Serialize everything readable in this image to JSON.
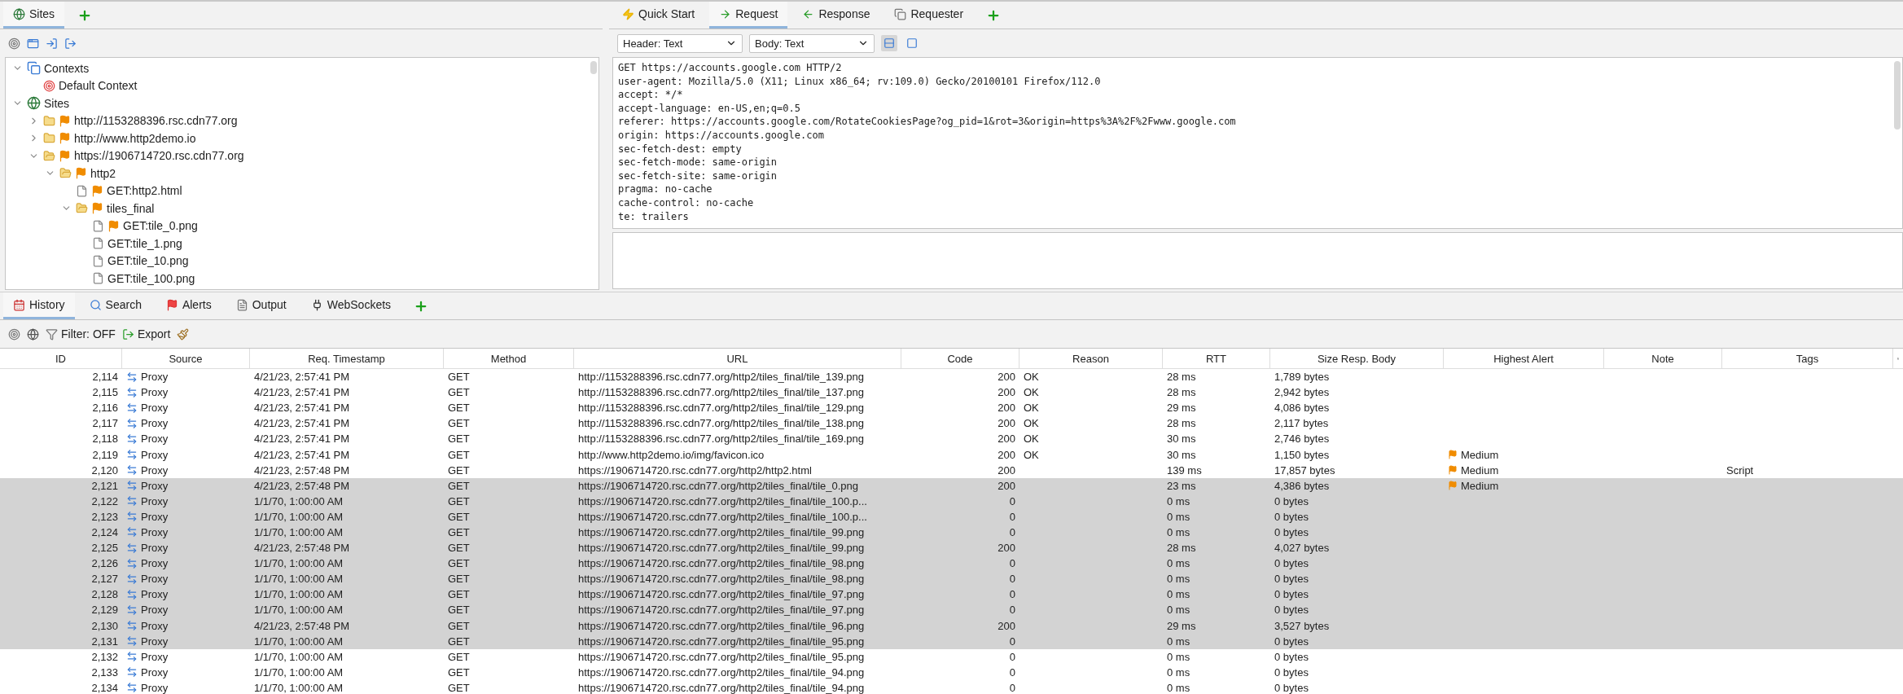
{
  "left_panel": {
    "tabs": [
      {
        "label": "Sites",
        "selected": true
      }
    ],
    "tree": [
      {
        "kind": "contexts",
        "label": "Contexts",
        "expanded": true,
        "children": [
          {
            "kind": "context",
            "label": "Default Context"
          }
        ]
      },
      {
        "kind": "sites",
        "label": "Sites",
        "expanded": true,
        "children": [
          {
            "kind": "folder",
            "label": "http://1153288396.rsc.cdn77.org",
            "flagged": true,
            "expanded": false
          },
          {
            "kind": "folder",
            "label": "http://www.http2demo.io",
            "flagged": true,
            "expanded": false
          },
          {
            "kind": "folder",
            "label": "https://1906714720.rsc.cdn77.org",
            "flagged": true,
            "expanded": true,
            "children": [
              {
                "kind": "folder",
                "label": "http2",
                "flagged": true,
                "expanded": true,
                "children": [
                  {
                    "kind": "file",
                    "label": "GET:http2.html",
                    "flagged": true
                  },
                  {
                    "kind": "folder",
                    "label": "tiles_final",
                    "flagged": true,
                    "expanded": true,
                    "children": [
                      {
                        "kind": "file",
                        "label": "GET:tile_0.png",
                        "flagged": true
                      },
                      {
                        "kind": "file",
                        "label": "GET:tile_1.png",
                        "flagged": false
                      },
                      {
                        "kind": "file",
                        "label": "GET:tile_10.png",
                        "flagged": false
                      },
                      {
                        "kind": "file",
                        "label": "GET:tile_100.png",
                        "flagged": false
                      }
                    ]
                  }
                ]
              }
            ]
          }
        ]
      }
    ]
  },
  "right_panel": {
    "tabs": [
      {
        "label": "Quick Start",
        "selected": false
      },
      {
        "label": "Request",
        "selected": true
      },
      {
        "label": "Response",
        "selected": false
      },
      {
        "label": "Requester",
        "selected": false
      }
    ],
    "header_format": "Header: Text",
    "body_format": "Body: Text",
    "view_toggles": [
      {
        "selected": true
      },
      {
        "selected": false
      }
    ],
    "request_lines": [
      "GET https://accounts.google.com HTTP/2",
      "user-agent: Mozilla/5.0 (X11; Linux x86_64; rv:109.0) Gecko/20100101 Firefox/112.0",
      "accept: */*",
      "accept-language: en-US,en;q=0.5",
      "referer: https://accounts.google.com/RotateCookiesPage?og_pid=1&rot=3&origin=https%3A%2F%2Fwww.google.com",
      "origin: https://accounts.google.com",
      "sec-fetch-dest: empty",
      "sec-fetch-mode: same-origin",
      "sec-fetch-site: same-origin",
      "pragma: no-cache",
      "cache-control: no-cache",
      "te: trailers"
    ]
  },
  "bottom_panel": {
    "tabs": [
      {
        "label": "History",
        "selected": true
      },
      {
        "label": "Search",
        "selected": false
      },
      {
        "label": "Alerts",
        "selected": false
      },
      {
        "label": "Output",
        "selected": false
      },
      {
        "label": "WebSockets",
        "selected": false
      }
    ],
    "filter": "Filter: OFF",
    "export": "Export",
    "table": {
      "columns": [
        "ID",
        "Source",
        "Req. Timestamp",
        "Method",
        "URL",
        "Code",
        "Reason",
        "RTT",
        "Size Resp. Body",
        "Highest Alert",
        "Note",
        "Tags"
      ],
      "rows": [
        {
          "id": "2,114",
          "source": "Proxy",
          "timestamp": "4/21/23, 2:57:41 PM",
          "method": "GET",
          "url": "http://1153288396.rsc.cdn77.org/http2/tiles_final/tile_139.png",
          "code": "200",
          "reason": "OK",
          "rtt": "28 ms",
          "size": "1,789 bytes",
          "selected": false
        },
        {
          "id": "2,115",
          "source": "Proxy",
          "timestamp": "4/21/23, 2:57:41 PM",
          "method": "GET",
          "url": "http://1153288396.rsc.cdn77.org/http2/tiles_final/tile_137.png",
          "code": "200",
          "reason": "OK",
          "rtt": "28 ms",
          "size": "2,942 bytes",
          "selected": false
        },
        {
          "id": "2,116",
          "source": "Proxy",
          "timestamp": "4/21/23, 2:57:41 PM",
          "method": "GET",
          "url": "http://1153288396.rsc.cdn77.org/http2/tiles_final/tile_129.png",
          "code": "200",
          "reason": "OK",
          "rtt": "29 ms",
          "size": "4,086 bytes",
          "selected": false
        },
        {
          "id": "2,117",
          "source": "Proxy",
          "timestamp": "4/21/23, 2:57:41 PM",
          "method": "GET",
          "url": "http://1153288396.rsc.cdn77.org/http2/tiles_final/tile_138.png",
          "code": "200",
          "reason": "OK",
          "rtt": "28 ms",
          "size": "2,117 bytes",
          "selected": false
        },
        {
          "id": "2,118",
          "source": "Proxy",
          "timestamp": "4/21/23, 2:57:41 PM",
          "method": "GET",
          "url": "http://1153288396.rsc.cdn77.org/http2/tiles_final/tile_169.png",
          "code": "200",
          "reason": "OK",
          "rtt": "30 ms",
          "size": "2,746 bytes",
          "selected": false
        },
        {
          "id": "2,119",
          "source": "Proxy",
          "timestamp": "4/21/23, 2:57:41 PM",
          "method": "GET",
          "url": "http://www.http2demo.io/img/favicon.ico",
          "code": "200",
          "reason": "OK",
          "rtt": "30 ms",
          "size": "1,150 bytes",
          "alert": "Medium",
          "selected": false
        },
        {
          "id": "2,120",
          "source": "Proxy",
          "timestamp": "4/21/23, 2:57:48 PM",
          "method": "GET",
          "url": "https://1906714720.rsc.cdn77.org/http2/http2.html",
          "code": "200",
          "rtt": "139 ms",
          "size": "17,857 bytes",
          "alert": "Medium",
          "tags": "Script",
          "selected": false
        },
        {
          "id": "2,121",
          "source": "Proxy",
          "timestamp": "4/21/23, 2:57:48 PM",
          "method": "GET",
          "url": "https://1906714720.rsc.cdn77.org/http2/tiles_final/tile_0.png",
          "code": "200",
          "rtt": "23 ms",
          "size": "4,386 bytes",
          "alert": "Medium",
          "selected": true
        },
        {
          "id": "2,122",
          "source": "Proxy",
          "timestamp": "1/1/70, 1:00:00 AM",
          "method": "GET",
          "url": "https://1906714720.rsc.cdn77.org/http2/tiles_final/tile_100.p...",
          "code": "0",
          "rtt": "0 ms",
          "size": "0 bytes",
          "selected": true
        },
        {
          "id": "2,123",
          "source": "Proxy",
          "timestamp": "1/1/70, 1:00:00 AM",
          "method": "GET",
          "url": "https://1906714720.rsc.cdn77.org/http2/tiles_final/tile_100.p...",
          "code": "0",
          "rtt": "0 ms",
          "size": "0 bytes",
          "selected": true
        },
        {
          "id": "2,124",
          "source": "Proxy",
          "timestamp": "1/1/70, 1:00:00 AM",
          "method": "GET",
          "url": "https://1906714720.rsc.cdn77.org/http2/tiles_final/tile_99.png",
          "code": "0",
          "rtt": "0 ms",
          "size": "0 bytes",
          "selected": true
        },
        {
          "id": "2,125",
          "source": "Proxy",
          "timestamp": "4/21/23, 2:57:48 PM",
          "method": "GET",
          "url": "https://1906714720.rsc.cdn77.org/http2/tiles_final/tile_99.png",
          "code": "200",
          "rtt": "28 ms",
          "size": "4,027 bytes",
          "selected": true
        },
        {
          "id": "2,126",
          "source": "Proxy",
          "timestamp": "1/1/70, 1:00:00 AM",
          "method": "GET",
          "url": "https://1906714720.rsc.cdn77.org/http2/tiles_final/tile_98.png",
          "code": "0",
          "rtt": "0 ms",
          "size": "0 bytes",
          "selected": true
        },
        {
          "id": "2,127",
          "source": "Proxy",
          "timestamp": "1/1/70, 1:00:00 AM",
          "method": "GET",
          "url": "https://1906714720.rsc.cdn77.org/http2/tiles_final/tile_98.png",
          "code": "0",
          "rtt": "0 ms",
          "size": "0 bytes",
          "selected": true
        },
        {
          "id": "2,128",
          "source": "Proxy",
          "timestamp": "1/1/70, 1:00:00 AM",
          "method": "GET",
          "url": "https://1906714720.rsc.cdn77.org/http2/tiles_final/tile_97.png",
          "code": "0",
          "rtt": "0 ms",
          "size": "0 bytes",
          "selected": true
        },
        {
          "id": "2,129",
          "source": "Proxy",
          "timestamp": "1/1/70, 1:00:00 AM",
          "method": "GET",
          "url": "https://1906714720.rsc.cdn77.org/http2/tiles_final/tile_97.png",
          "code": "0",
          "rtt": "0 ms",
          "size": "0 bytes",
          "selected": true
        },
        {
          "id": "2,130",
          "source": "Proxy",
          "timestamp": "4/21/23, 2:57:48 PM",
          "method": "GET",
          "url": "https://1906714720.rsc.cdn77.org/http2/tiles_final/tile_96.png",
          "code": "200",
          "rtt": "29 ms",
          "size": "3,527 bytes",
          "selected": true
        },
        {
          "id": "2,131",
          "source": "Proxy",
          "timestamp": "1/1/70, 1:00:00 AM",
          "method": "GET",
          "url": "https://1906714720.rsc.cdn77.org/http2/tiles_final/tile_95.png",
          "code": "0",
          "rtt": "0 ms",
          "size": "0 bytes",
          "selected": true
        },
        {
          "id": "2,132",
          "source": "Proxy",
          "timestamp": "1/1/70, 1:00:00 AM",
          "method": "GET",
          "url": "https://1906714720.rsc.cdn77.org/http2/tiles_final/tile_95.png",
          "code": "0",
          "rtt": "0 ms",
          "size": "0 bytes",
          "selected": false
        },
        {
          "id": "2,133",
          "source": "Proxy",
          "timestamp": "1/1/70, 1:00:00 AM",
          "method": "GET",
          "url": "https://1906714720.rsc.cdn77.org/http2/tiles_final/tile_94.png",
          "code": "0",
          "rtt": "0 ms",
          "size": "0 bytes",
          "selected": false
        },
        {
          "id": "2,134",
          "source": "Proxy",
          "timestamp": "1/1/70, 1:00:00 AM",
          "method": "GET",
          "url": "https://1906714720.rsc.cdn77.org/http2/tiles_final/tile_94.png",
          "code": "0",
          "rtt": "0 ms",
          "size": "0 bytes",
          "selected": false
        }
      ]
    }
  }
}
